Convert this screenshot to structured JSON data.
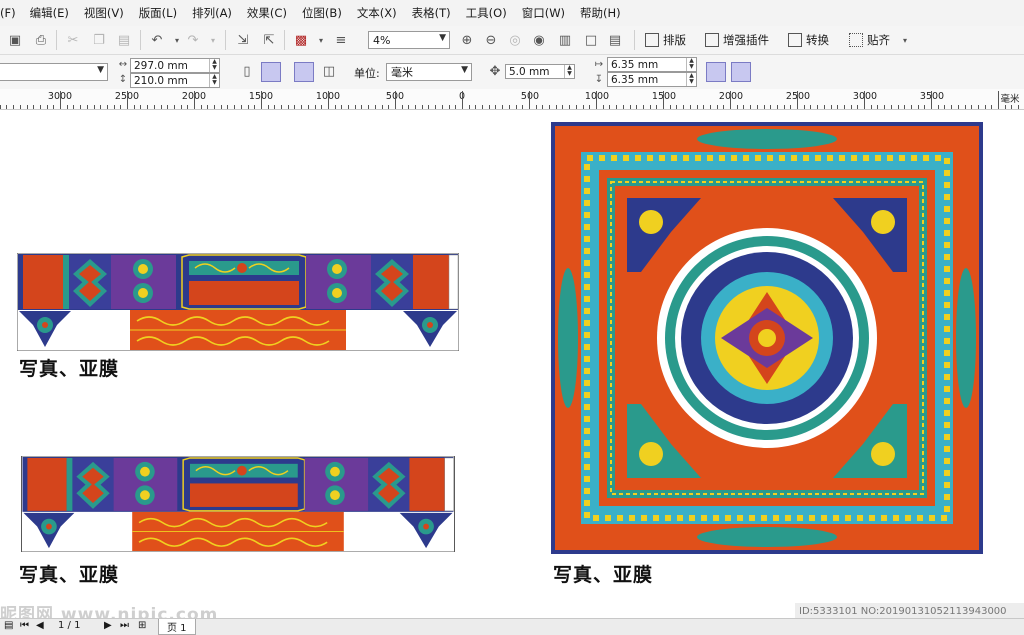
{
  "menu": [
    "(F)",
    "编辑(E)",
    "视图(V)",
    "版面(L)",
    "排列(A)",
    "效果(C)",
    "位图(B)",
    "文本(X)",
    "表格(T)",
    "工具(O)",
    "窗口(W)",
    "帮助(H)"
  ],
  "toolbar": {
    "zoom_value": "4%",
    "plugins": [
      "排版",
      "增强插件",
      "转换",
      "贴齐"
    ]
  },
  "property_bar": {
    "width": "297.0 mm",
    "height": "210.0 mm",
    "unit_label": "单位:",
    "unit_value": "毫米",
    "nudge": "5.0 mm",
    "dup_x": "6.35 mm",
    "dup_y": "6.35 mm"
  },
  "ruler": {
    "labels": [
      "3000",
      "2500",
      "2000",
      "1500",
      "1000",
      "500",
      "0",
      "500",
      "1000",
      "1500",
      "2000",
      "2500",
      "3000",
      "3500"
    ],
    "unit": "毫米"
  },
  "canvas": {
    "caption_1": "写真、亚膜",
    "caption_2": "写真、亚膜",
    "caption_3": "写真、亚膜"
  },
  "status": {
    "page_count": "1 / 1",
    "page_tab": "页 1"
  },
  "overlay": {
    "watermark": "昵图网 www.nipic.com",
    "image_id": "ID:5333101 NO:20190131052113943000"
  },
  "colors": {
    "vermilion": "#d4451c",
    "ultramarine": "#2d3a8c",
    "teal": "#2a9a8c",
    "gold": "#f0d020",
    "panel": "#f3f3f3"
  }
}
